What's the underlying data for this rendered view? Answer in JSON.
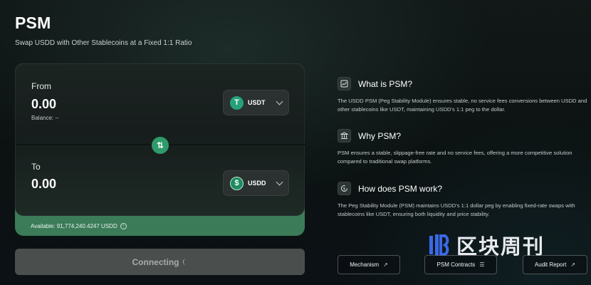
{
  "header": {
    "title": "PSM",
    "subtitle": "Swap USDD with Other Stablecoins at a Fixed 1:1 Ratio"
  },
  "swap": {
    "from": {
      "label": "From",
      "amount": "0.00",
      "balance": "Balance: --",
      "token": "USDT",
      "token_icon": "tether-icon"
    },
    "to": {
      "label": "To",
      "amount": "0.00",
      "token": "USDD",
      "token_icon": "usdd-icon"
    },
    "available": "Available: 91,774,240.4247 USDD",
    "connect_button": "Connecting"
  },
  "info": [
    {
      "icon": "chart-icon",
      "title": "What is PSM?",
      "body": "The USDD PSM (Peg Stability Module) ensures stable, no service fees conversions between USDD and other stablecoins like USDT, maintaining USDD's 1:1 peg to the dollar."
    },
    {
      "icon": "bank-icon",
      "title": "Why PSM?",
      "body": "PSM ensures a stable, slippage-free rate and no service fees, offering a more competitive solution compared to traditional swap platforms."
    },
    {
      "icon": "refresh-dollar-icon",
      "title": "How does PSM work?",
      "body": "The Peg Stability Module (PSM) maintains USDD's 1:1 dollar peg by enabling fixed-rate swaps with stablecoins like USDT, ensuring both liquidity and price stability."
    }
  ],
  "links": [
    {
      "label": "Mechanism",
      "icon": "external-link-icon"
    },
    {
      "label": "PSM Contracts",
      "icon": "list-icon"
    },
    {
      "label": "Audit Report",
      "icon": "external-link-icon"
    }
  ],
  "watermark": {
    "text": "区块周刊"
  },
  "colors": {
    "accent": "#2f9a6a",
    "tether": "#26a17b",
    "button_disabled": "#4a4f4e"
  }
}
